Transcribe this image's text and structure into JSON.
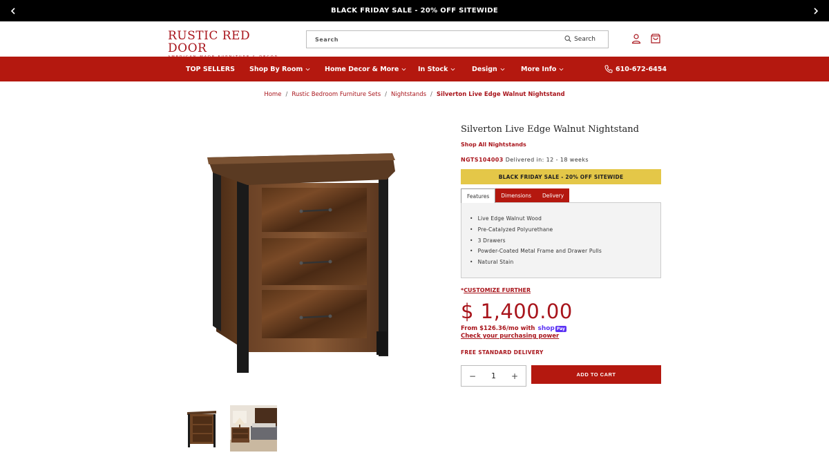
{
  "announcement": {
    "text": "BLACK FRIDAY SALE - 20% OFF SITEWIDE"
  },
  "header": {
    "logo_name": "RUSTIC RED DOOR",
    "logo_tagline": "AMERICAN-MADE FURNITURE & DECOR",
    "search_placeholder": "Search",
    "search_button": "Search"
  },
  "nav": {
    "items": [
      {
        "label": "TOP SELLERS",
        "dropdown": false
      },
      {
        "label": "Shop By Room",
        "dropdown": true
      },
      {
        "label": "Home Decor & More",
        "dropdown": true
      },
      {
        "label": "In Stock",
        "dropdown": true
      },
      {
        "label": "Design",
        "dropdown": true
      },
      {
        "label": "More Info",
        "dropdown": true
      }
    ],
    "phone": "610-672-6454"
  },
  "breadcrumb": {
    "items": [
      "Home",
      "Rustic Bedroom Furniture Sets",
      "Nightstands"
    ],
    "current": "Silverton Live Edge Walnut Nightstand"
  },
  "product": {
    "title": "Silverton Live Edge Walnut Nightstand",
    "shop_all": "Shop All Nightstands",
    "sku": "NGTS104003",
    "delivery": "Delivered in: 12 - 18 weeks",
    "promo": "BLACK FRIDAY SALE - 20% OFF SITEWIDE",
    "tabs": [
      "Features",
      "Dimensions",
      "Delivery"
    ],
    "features": [
      "Live Edge Walnut Wood",
      "Pre-Catalyzed Polyurethane",
      "3 Drawers",
      "Powder-Coated Metal Frame and Drawer Pulls",
      "Natural Stain"
    ],
    "customize_prefix": "*",
    "customize_link": "CUSTOMIZE FURTHER",
    "price": "$ 1,400.00",
    "installments": "From $126.36/mo with",
    "shoppay_shop": "shop",
    "shoppay_pay": "Pay",
    "purchasing_power": "Check your purchasing power",
    "free_delivery": "FREE STANDARD DELIVERY",
    "quantity": "1",
    "qty_minus": "−",
    "qty_plus": "+",
    "add_to_cart": "ADD TO CART"
  },
  "colors": {
    "brand_red": "#b4180f",
    "promo_yellow": "#e4c748",
    "shoppay": "#5a31f4"
  }
}
